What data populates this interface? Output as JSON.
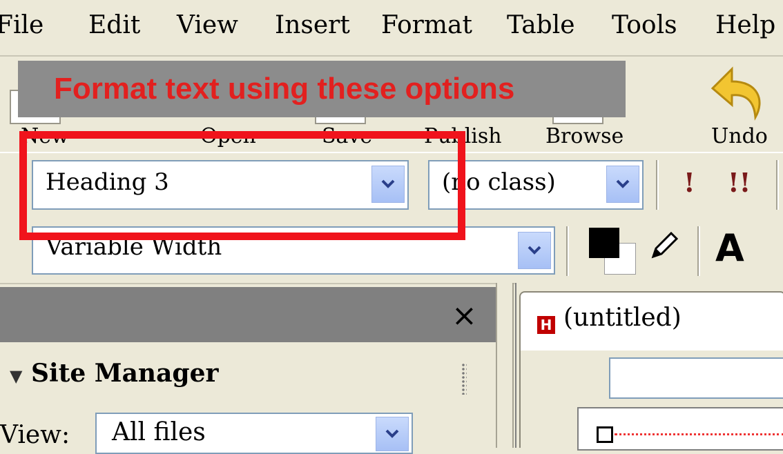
{
  "menu": [
    {
      "label": "File"
    },
    {
      "label": "Edit"
    },
    {
      "label": "View"
    },
    {
      "label": "Insert"
    },
    {
      "label": "Format"
    },
    {
      "label": "Table"
    },
    {
      "label": "Tools"
    },
    {
      "label": "Help"
    }
  ],
  "banner": {
    "text": "Format text using these options"
  },
  "toolbar": {
    "new": "New",
    "open": "Open",
    "save": "Save",
    "publish": "Publish",
    "browse": "Browse",
    "undo": "Undo"
  },
  "format": {
    "paragraph_style": "Heading 3",
    "css_class": "(no class)",
    "font_family": "Variable Width",
    "emphasis": "!",
    "strong": "!!",
    "text_color": "#000000",
    "background_color": "#ffffff",
    "font_size_icon": "A"
  },
  "site_manager": {
    "close": "×",
    "title": "Site Manager",
    "view_label": "View:",
    "view_value": "All files"
  },
  "document": {
    "tab_title": "(untitled)",
    "tab_icon": "H"
  },
  "colors": {
    "highlight": "#f0131c",
    "banner_bg": "#8c8c8c",
    "panel_header": "#808080"
  }
}
